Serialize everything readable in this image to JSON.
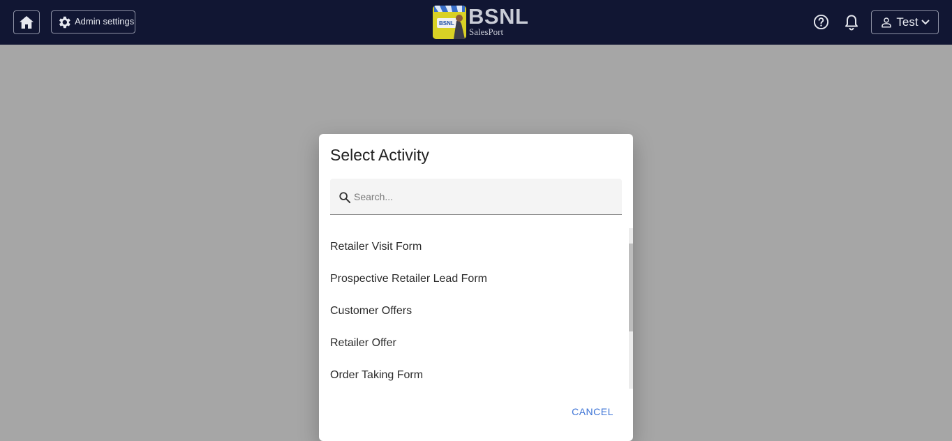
{
  "header": {
    "admin_label": "Admin settings",
    "brand_title": "BSNL",
    "brand_subtitle": "SalesPort",
    "brand_badge": "BSNL",
    "user_label": "Test"
  },
  "dialog": {
    "title": "Select Activity",
    "search_placeholder": "Search...",
    "items": [
      {
        "label": "Retailer Visit Form"
      },
      {
        "label": "Prospective Retailer Lead Form"
      },
      {
        "label": "Customer Offers"
      },
      {
        "label": "Retailer Offer"
      },
      {
        "label": "Order Taking Form"
      }
    ],
    "cancel_label": "CANCEL"
  },
  "colors": {
    "topbar": "#111633",
    "backdrop": "#a6a6a6",
    "accent": "#3d74d6"
  },
  "icons": [
    "home-icon",
    "gear-icon",
    "help-icon",
    "bell-icon",
    "user-icon",
    "chevron-down-icon",
    "search-icon"
  ]
}
